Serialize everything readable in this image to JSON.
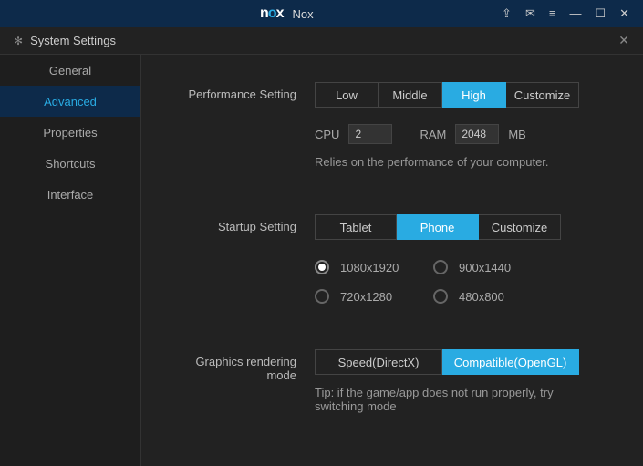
{
  "topbar": {
    "app_name": "Nox"
  },
  "settings": {
    "title": "System Settings"
  },
  "sidebar": {
    "items": [
      {
        "label": "General"
      },
      {
        "label": "Advanced"
      },
      {
        "label": "Properties"
      },
      {
        "label": "Shortcuts"
      },
      {
        "label": "Interface"
      }
    ],
    "active_index": 1
  },
  "perf": {
    "label": "Performance Setting",
    "options": [
      "Low",
      "Middle",
      "High",
      "Customize"
    ],
    "active": "High",
    "cpu_label": "CPU",
    "cpu_value": "2",
    "ram_label": "RAM",
    "ram_value": "2048",
    "ram_unit": "MB",
    "hint": "Relies on the performance of your computer."
  },
  "startup": {
    "label": "Startup Setting",
    "options": [
      "Tablet",
      "Phone",
      "Customize"
    ],
    "active": "Phone",
    "resolutions": [
      "1080x1920",
      "900x1440",
      "720x1280",
      "480x800"
    ],
    "selected_res": "1080x1920"
  },
  "graphics": {
    "label": "Graphics rendering mode",
    "options": [
      "Speed(DirectX)",
      "Compatible(OpenGL)"
    ],
    "active": "Compatible(OpenGL)",
    "hint": "Tip: if the game/app does not run properly, try switching mode"
  }
}
